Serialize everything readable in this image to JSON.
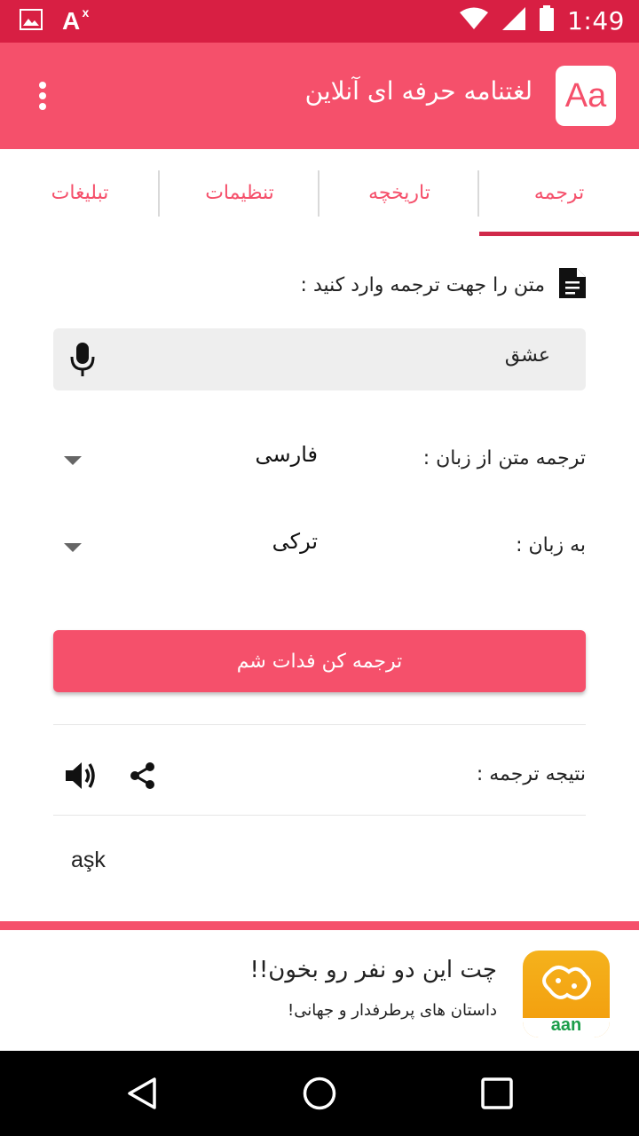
{
  "status_bar": {
    "time": "1:49",
    "ax_label": "A",
    "ax_sup": "x"
  },
  "app_bar": {
    "logo_text": "Aa",
    "title": "لغتنامه حرفه ای آنلاین"
  },
  "tabs": [
    {
      "label": "ترجمه",
      "active": true
    },
    {
      "label": "تاریخچه",
      "active": false
    },
    {
      "label": "تنظیمات",
      "active": false
    },
    {
      "label": "تبلیغات",
      "active": false
    }
  ],
  "prompt": {
    "text": "متن را جهت ترجمه وارد کنید :"
  },
  "input": {
    "value": "عشق"
  },
  "from_lang": {
    "label": "ترجمه متن از زبان :",
    "value": "فارسی"
  },
  "to_lang": {
    "label": "به زبان :",
    "value": "ترکی"
  },
  "translate_button": {
    "label": "ترجمه کن فدات شم"
  },
  "result": {
    "label": "نتیجه ترجمه :",
    "text": "aşk"
  },
  "ad": {
    "title": "چت این دو نفر رو بخون!!",
    "subtitle": "داستان های پرطرفدار و جهانی!",
    "brand": "aan"
  },
  "colors": {
    "primary": "#f5506b",
    "status_bar": "#d81f43",
    "tab_indicator": "#d0294a"
  }
}
